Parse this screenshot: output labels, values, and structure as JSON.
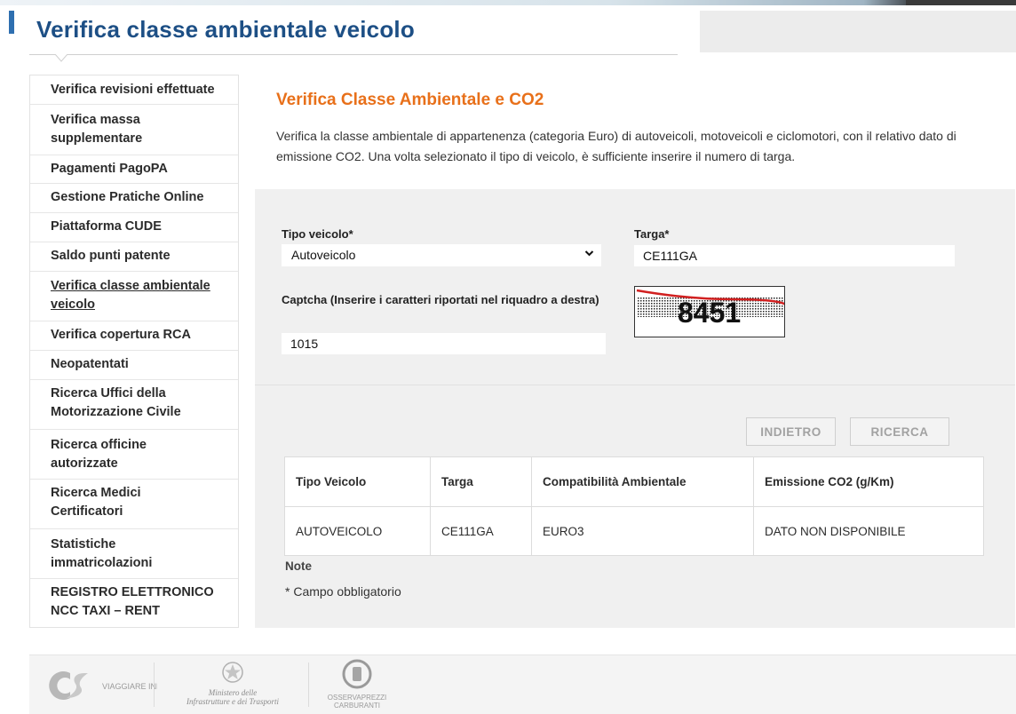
{
  "header": {
    "title": "Verifica classe ambientale veicolo"
  },
  "sidebar": {
    "items": [
      {
        "label": "Verifica revisioni effettuate"
      },
      {
        "label": "Verifica massa supplementare"
      },
      {
        "label": "Pagamenti PagoPA"
      },
      {
        "label": "Gestione Pratiche Online"
      },
      {
        "label": "Piattaforma CUDE"
      },
      {
        "label": "Saldo punti patente"
      },
      {
        "label": "Verifica classe ambientale veicolo"
      },
      {
        "label": "Verifica copertura RCA"
      },
      {
        "label": "Neopatentati"
      },
      {
        "label": "Ricerca Uffici della Motorizzazione Civile"
      },
      {
        "label": "Ricerca officine autorizzate"
      },
      {
        "label": "Ricerca Medici Certificatori"
      },
      {
        "label": "Statistiche immatricolazioni"
      },
      {
        "label": "REGISTRO ELETTRONICO NCC TAXI – RENT"
      }
    ]
  },
  "main": {
    "heading": "Verifica Classe Ambientale e CO2",
    "description": "Verifica la classe ambientale di appartenenza (categoria Euro) di autoveicoli, motoveicoli e ciclomotori, con il relativo dato di emissione CO2. Una volta selezionato il tipo di veicolo, è sufficiente inserire il numero di targa."
  },
  "form": {
    "tipo_label": "Tipo veicolo*",
    "tipo_value": "Autoveicolo",
    "targa_label": "Targa*",
    "targa_value": "CE111GA",
    "captcha_label": "Captcha (Inserire i caratteri riportati nel riquadro a destra)",
    "captcha_value": "1015",
    "captcha_image_text": "8451"
  },
  "buttons": {
    "back": "INDIETRO",
    "search": "RICERCA"
  },
  "results": {
    "headers": [
      "Tipo Veicolo",
      "Targa",
      "Compatibilità Ambientale",
      "Emissione CO2 (g/Km)"
    ],
    "rows": [
      [
        "AUTOVEICOLO",
        "CE111GA",
        "EURO3",
        "DATO NON DISPONIBILE"
      ]
    ]
  },
  "notes": {
    "title": "Note",
    "text": "* Campo obbligatorio"
  },
  "footer": {
    "logo1": "VIAGGIARE INFORMATI",
    "logo2_line1": "Ministero delle",
    "logo2_line2": "Infrastrutture e dei Trasporti",
    "logo3_line1": "OSSERVAPREZZI",
    "logo3_line2": "CARBURANTI"
  },
  "colors": {
    "title_blue": "#1d4f85",
    "heading_orange": "#e8701a",
    "panel_grey": "#f0f0f0"
  }
}
